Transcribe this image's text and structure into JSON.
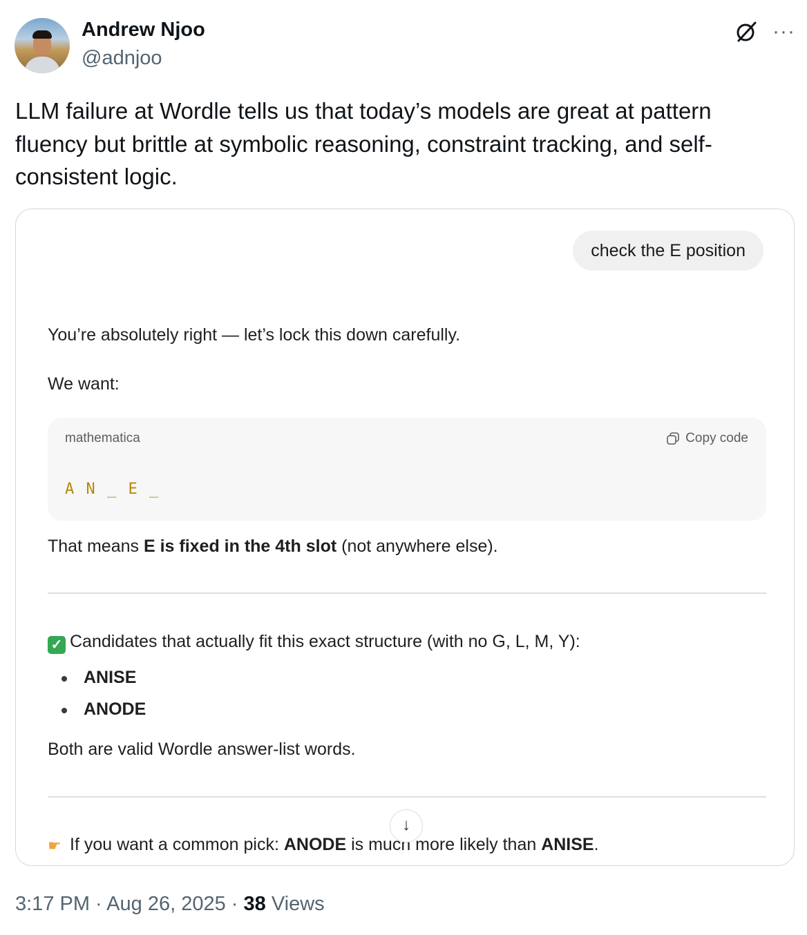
{
  "author": {
    "name": "Andrew Njoo",
    "handle": "@adnjoo"
  },
  "header_icons": [
    "grok-icon",
    "more-icon"
  ],
  "more_glyph": "···",
  "tweet_text": "LLM failure at Wordle tells us that today’s models are great at pattern fluency but brittle at symbolic reasoning, constraint tracking, and self-consistent logic.",
  "chat": {
    "user_message": "check the E position",
    "reply_intro": "You’re absolutely right — let’s lock this down carefully.",
    "we_want": "We want:",
    "code": {
      "language": "mathematica",
      "copy_label": "Copy code",
      "content": "A N _ E _"
    },
    "meaning": {
      "prefix": "That means ",
      "bold": "E is fixed in the 4th slot",
      "suffix": " (not anywhere else)."
    },
    "candidates_heading": "Candidates that actually fit this exact structure (with no G, L, M, Y):",
    "candidates": [
      "ANISE",
      "ANODE"
    ],
    "both_valid": "Both are valid Wordle answer-list words.",
    "pick": {
      "prefix": "If you want a common pick: ",
      "bold1": "ANODE",
      "middle": " is much more likely than ",
      "bold2": "ANISE",
      "end": "."
    },
    "scroll_glyph": "↓"
  },
  "meta": {
    "time": "3:17 PM",
    "sep": " · ",
    "date": "Aug 26, 2025",
    "views_count": "38",
    "views_label": " Views"
  },
  "colors": {
    "code_text": "#b8860b",
    "handle": "#536471",
    "card_border": "#cfd9de"
  }
}
